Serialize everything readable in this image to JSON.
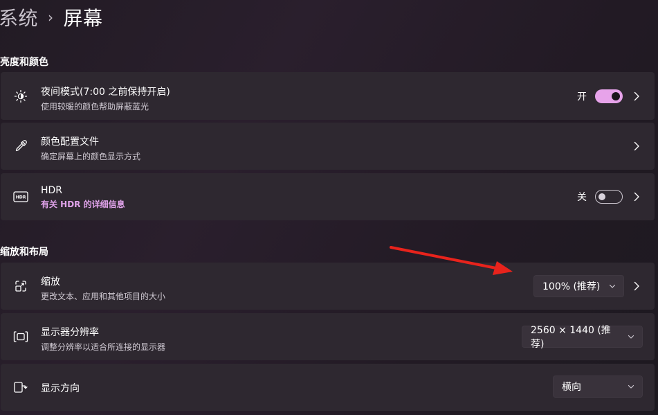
{
  "breadcrumb": {
    "parent": "系统",
    "separator": "›",
    "current": "屏幕"
  },
  "sections": {
    "brightness_color": "亮度和颜色",
    "scale_layout": "缩放和布局"
  },
  "night_light": {
    "title": "夜间模式(7:00 之前保持开启)",
    "subtitle": "使用较暖的颜色帮助屏蔽蓝光",
    "state_label": "开",
    "state": "on",
    "icon": "brightness-icon"
  },
  "color_profile": {
    "title": "颜色配置文件",
    "subtitle": "确定屏幕上的颜色显示方式",
    "icon": "eyedropper-icon"
  },
  "hdr": {
    "title": "HDR",
    "subtitle": "有关 HDR 的详细信息",
    "state_label": "关",
    "state": "off",
    "icon": "hdr-icon"
  },
  "scale": {
    "title": "缩放",
    "subtitle": "更改文本、应用和其他项目的大小",
    "value": "100% (推荐)",
    "icon": "scale-icon"
  },
  "resolution": {
    "title": "显示器分辨率",
    "subtitle": "调整分辨率以适合所连接的显示器",
    "value": "2560 × 1440 (推荐)",
    "icon": "resolution-icon"
  },
  "orientation": {
    "title": "显示方向",
    "value": "横向",
    "icon": "orientation-icon"
  },
  "colors": {
    "accent": "#e7a3ea",
    "card_bg": "#2e2830",
    "annotation_arrow": "#e8231c"
  }
}
